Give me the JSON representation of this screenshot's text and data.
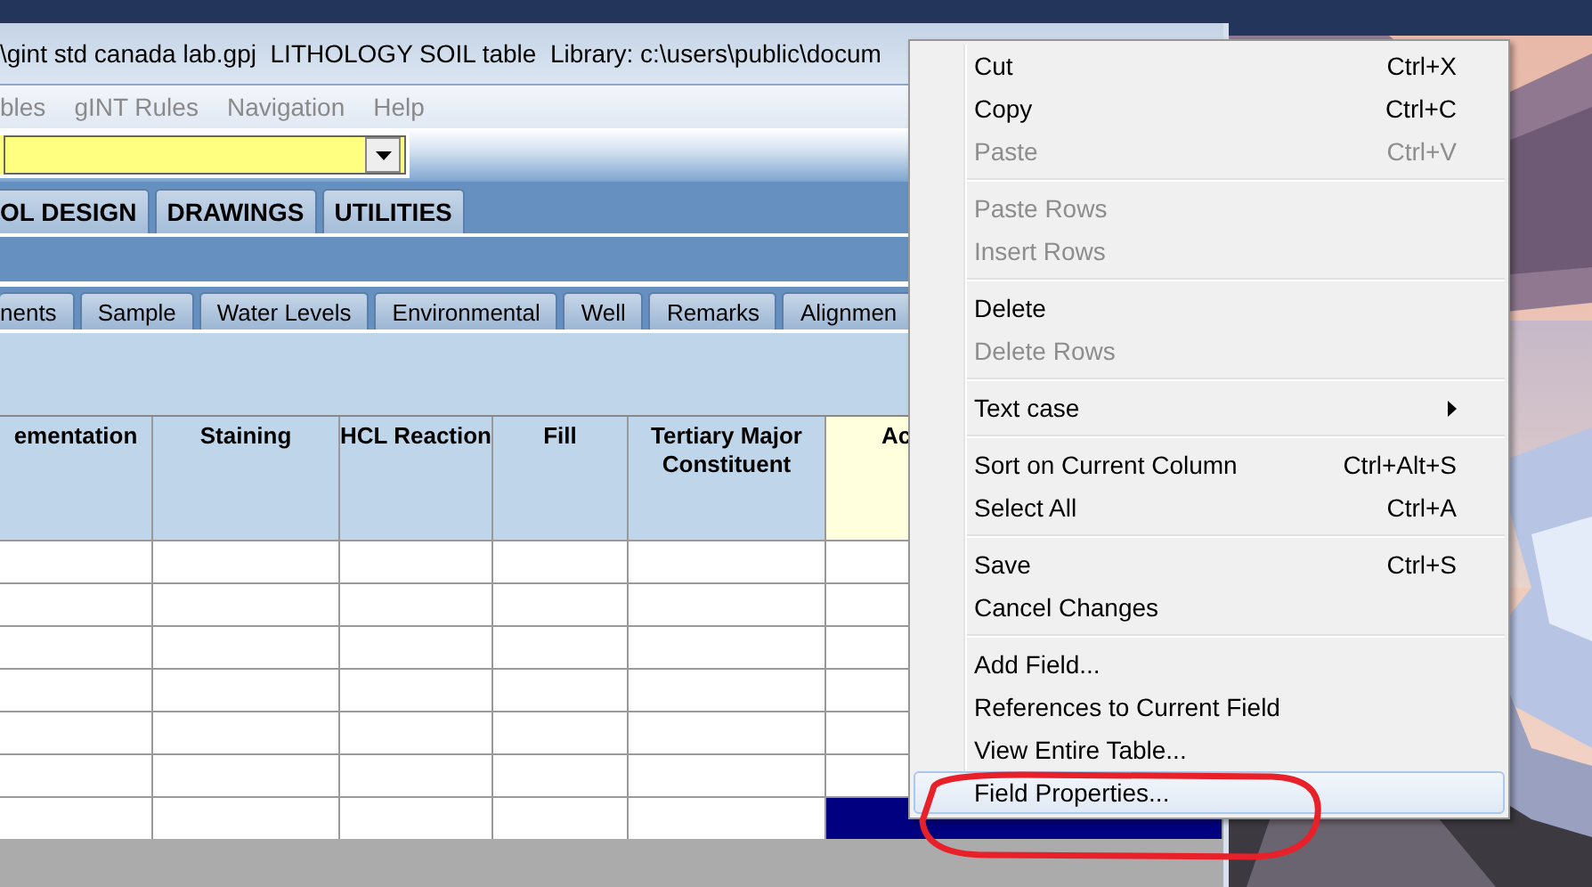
{
  "window": {
    "title": "\\gint std canada lab.gpj  LITHOLOGY SOIL table  Library: c:\\users\\public\\docum"
  },
  "menu_bar": [
    {
      "label": "bles"
    },
    {
      "label": "gINT Rules"
    },
    {
      "label": "Navigation"
    },
    {
      "label": "Help"
    }
  ],
  "module_tabs": [
    {
      "label": "OL DESIGN"
    },
    {
      "label": "DRAWINGS"
    },
    {
      "label": "UTILITIES"
    }
  ],
  "table_tabs": [
    {
      "label": "nents"
    },
    {
      "label": "Sample"
    },
    {
      "label": "Water Levels"
    },
    {
      "label": "Environmental"
    },
    {
      "label": "Well"
    },
    {
      "label": "Remarks"
    },
    {
      "label": "Alignmen"
    }
  ],
  "table": {
    "columns": [
      {
        "label": "ementation",
        "current": false
      },
      {
        "label": "Staining",
        "current": false
      },
      {
        "label": "HCL Reaction",
        "current": false
      },
      {
        "label": "Fill",
        "current": false
      },
      {
        "label": "Tertiary Major Constituent",
        "current": false
      },
      {
        "label": "Ac",
        "current": true
      }
    ],
    "rows": [
      {
        "cells": [
          {
            "selected": false
          },
          {
            "selected": false
          },
          {
            "selected": false
          },
          {
            "selected": false
          },
          {
            "selected": false
          },
          {
            "selected": false
          }
        ]
      },
      {
        "cells": [
          {
            "selected": false
          },
          {
            "selected": false
          },
          {
            "selected": false
          },
          {
            "selected": false
          },
          {
            "selected": false
          },
          {
            "selected": false
          }
        ]
      },
      {
        "cells": [
          {
            "selected": false
          },
          {
            "selected": false
          },
          {
            "selected": false
          },
          {
            "selected": false
          },
          {
            "selected": false
          },
          {
            "selected": false
          }
        ]
      },
      {
        "cells": [
          {
            "selected": false
          },
          {
            "selected": false
          },
          {
            "selected": false
          },
          {
            "selected": false
          },
          {
            "selected": false
          },
          {
            "selected": false
          }
        ]
      },
      {
        "cells": [
          {
            "selected": false
          },
          {
            "selected": false
          },
          {
            "selected": false
          },
          {
            "selected": false
          },
          {
            "selected": false
          },
          {
            "selected": false
          }
        ]
      },
      {
        "cells": [
          {
            "selected": false
          },
          {
            "selected": false
          },
          {
            "selected": false
          },
          {
            "selected": false
          },
          {
            "selected": false
          },
          {
            "selected": false
          }
        ]
      },
      {
        "cells": [
          {
            "selected": false
          },
          {
            "selected": false
          },
          {
            "selected": false
          },
          {
            "selected": false
          },
          {
            "selected": false
          },
          {
            "selected": true
          }
        ]
      }
    ]
  },
  "context_menu": {
    "items": [
      {
        "kind": "item",
        "label": "Cut",
        "shortcut": "Ctrl+X",
        "disabled": false,
        "selected": false
      },
      {
        "kind": "item",
        "label": "Copy",
        "shortcut": "Ctrl+C",
        "disabled": false,
        "selected": false
      },
      {
        "kind": "item",
        "label": "Paste",
        "shortcut": "Ctrl+V",
        "disabled": true,
        "selected": false
      },
      {
        "kind": "separator"
      },
      {
        "kind": "item",
        "label": "Paste Rows",
        "disabled": true,
        "selected": false
      },
      {
        "kind": "item",
        "label": "Insert Rows",
        "disabled": true,
        "selected": false
      },
      {
        "kind": "separator"
      },
      {
        "kind": "item",
        "label": "Delete",
        "disabled": false,
        "selected": false
      },
      {
        "kind": "item",
        "label": "Delete Rows",
        "disabled": true,
        "selected": false
      },
      {
        "kind": "separator"
      },
      {
        "kind": "submenu",
        "label": "Text case",
        "disabled": false,
        "selected": false
      },
      {
        "kind": "separator"
      },
      {
        "kind": "item",
        "label": "Sort on Current Column",
        "shortcut": "Ctrl+Alt+S",
        "disabled": false,
        "selected": false
      },
      {
        "kind": "item",
        "label": "Select All",
        "shortcut": "Ctrl+A",
        "disabled": false,
        "selected": false
      },
      {
        "kind": "separator"
      },
      {
        "kind": "item",
        "label": "Save",
        "shortcut": "Ctrl+S",
        "disabled": false,
        "selected": false
      },
      {
        "kind": "item",
        "label": "Cancel Changes",
        "disabled": false,
        "selected": false
      },
      {
        "kind": "separator"
      },
      {
        "kind": "item",
        "label": "Add Field...",
        "disabled": false,
        "selected": false
      },
      {
        "kind": "item",
        "label": "References to Current Field",
        "disabled": false,
        "selected": false
      },
      {
        "kind": "item",
        "label": "View Entire Table...",
        "disabled": false,
        "selected": false
      },
      {
        "kind": "item",
        "label": "Field Properties...",
        "disabled": false,
        "selected": true
      }
    ]
  }
}
